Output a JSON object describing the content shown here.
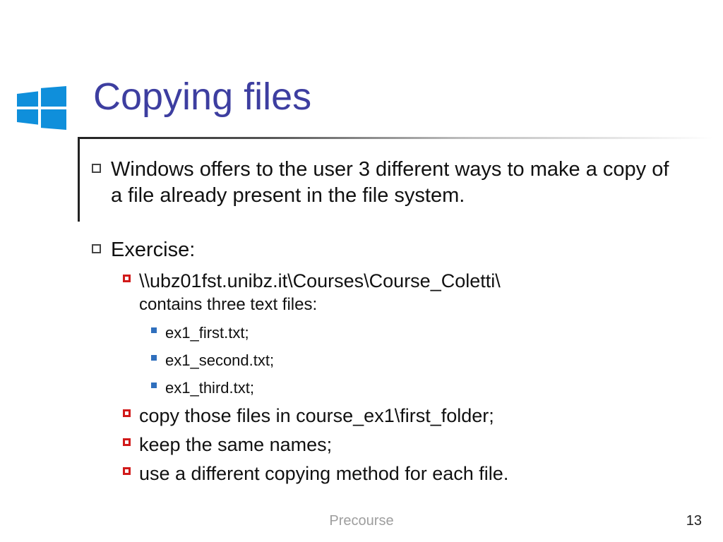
{
  "title": "Copying files",
  "intro": "Windows offers to the user 3 different ways to make a copy of a file already present in the file system.",
  "exercise_label": "Exercise:",
  "path": "\\\\ubz01fst.unibz.it\\Courses\\Course_Coletti\\",
  "path_note": "contains three text files:",
  "files": [
    "ex1_first.txt;",
    "ex1_second.txt;",
    "ex1_third.txt;"
  ],
  "steps": [
    "copy those files in course_ex1\\first_folder;",
    "keep the same names;",
    "use a different copying method for each file."
  ],
  "footer": "Precourse",
  "page": "13"
}
